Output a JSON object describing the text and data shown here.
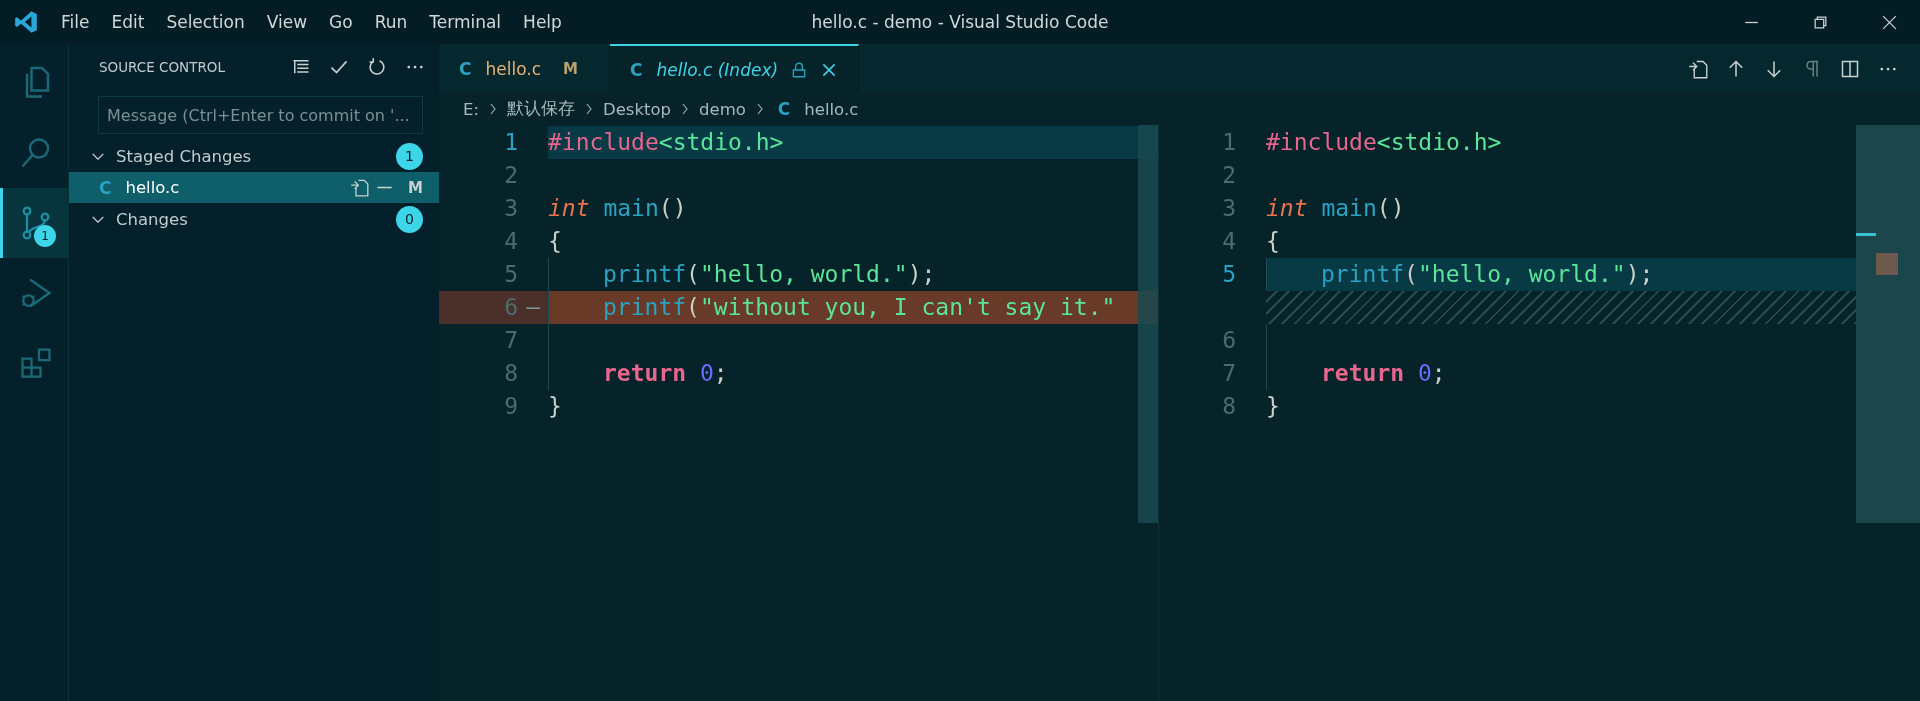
{
  "titlebar": {
    "menus": [
      "File",
      "Edit",
      "Selection",
      "View",
      "Go",
      "Run",
      "Terminal",
      "Help"
    ],
    "title": "hello.c - demo - Visual Studio Code"
  },
  "activity_bar": [
    {
      "kind": "files",
      "selected": false
    },
    {
      "kind": "search",
      "selected": false
    },
    {
      "kind": "source-control",
      "selected": true,
      "badge": "1"
    },
    {
      "kind": "run",
      "selected": false
    },
    {
      "kind": "extensions",
      "selected": false
    }
  ],
  "sidebar": {
    "title": "SOURCE CONTROL",
    "message": {
      "placeholder": "Message (Ctrl+Enter to commit on '..."
    },
    "groups": [
      {
        "label": "Staged Changes",
        "count": "1",
        "expanded": true,
        "files": [
          {
            "icon_letter": "C",
            "name": "hello.c",
            "status": "M",
            "selected": true
          }
        ]
      },
      {
        "label": "Changes",
        "count": "0",
        "expanded": true
      }
    ]
  },
  "tabs": [
    {
      "icon_letter": "C",
      "label": "hello.c",
      "status": "M",
      "selected": false,
      "locked": false
    },
    {
      "icon_letter": "C",
      "label": "hello.c (Index)",
      "selected": true,
      "locked": true
    }
  ],
  "breadcrumb": [
    {
      "label": "E:"
    },
    {
      "label": "默认保存"
    },
    {
      "label": "Desktop"
    },
    {
      "label": "demo"
    },
    {
      "icon_letter": "C",
      "label": "hello.c"
    }
  ],
  "diff": {
    "left": {
      "lines": [
        {
          "number": "1",
          "kind": "current",
          "tokens": [
            {
              "t": "#include",
              "kind": "pre"
            },
            {
              "t": "<stdio.h>",
              "kind": "str"
            }
          ]
        },
        {
          "number": "2",
          "kind": "normal"
        },
        {
          "number": "3",
          "kind": "normal",
          "tokens": [
            {
              "t": "int",
              "kind": "type"
            },
            {
              "t": " main",
              "kind": "fn"
            },
            {
              "t": "()",
              "kind": "punct"
            }
          ]
        },
        {
          "number": "4",
          "kind": "normal",
          "tokens": [
            {
              "t": "{",
              "kind": "punct"
            }
          ]
        },
        {
          "number": "5",
          "kind": "normal",
          "indented": true,
          "tokens": [
            {
              "t": "printf",
              "kind": "fn"
            },
            {
              "t": "(",
              "kind": "punct"
            },
            {
              "t": "\"hello, world.\"",
              "kind": "str"
            },
            {
              "t": ");",
              "kind": "punct"
            }
          ]
        },
        {
          "number": "6",
          "kind": "removed",
          "marker": "—",
          "indented": true,
          "tokens": [
            {
              "t": "printf",
              "kind": "fn"
            },
            {
              "t": "(",
              "kind": "punct"
            },
            {
              "t": "\"without you, I can't say it.\"",
              "kind": "str"
            }
          ]
        },
        {
          "number": "7",
          "kind": "normal",
          "indented": true
        },
        {
          "number": "8",
          "kind": "normal",
          "indented": true,
          "tokens": [
            {
              "t": "return",
              "kind": "kw"
            },
            {
              "t": " 0",
              "kind": "num"
            },
            {
              "t": ";",
              "kind": "punct"
            }
          ]
        },
        {
          "number": "9",
          "kind": "normal",
          "tokens": [
            {
              "t": "}",
              "kind": "punct"
            }
          ]
        }
      ]
    },
    "right": {
      "lines": [
        {
          "number": "1",
          "kind": "normal",
          "tokens": [
            {
              "t": "#include",
              "kind": "pre"
            },
            {
              "t": "<stdio.h>",
              "kind": "str"
            }
          ]
        },
        {
          "number": "2",
          "kind": "normal"
        },
        {
          "number": "3",
          "kind": "normal",
          "tokens": [
            {
              "t": "int",
              "kind": "type"
            },
            {
              "t": " main",
              "kind": "fn"
            },
            {
              "t": "()",
              "kind": "punct"
            }
          ]
        },
        {
          "number": "4",
          "kind": "normal",
          "tokens": [
            {
              "t": "{",
              "kind": "punct"
            }
          ]
        },
        {
          "number": "5",
          "kind": "current",
          "indented": true,
          "tokens": [
            {
              "t": "printf",
              "kind": "fn"
            },
            {
              "t": "(",
              "kind": "punct"
            },
            {
              "t": "\"hello, world.\"",
              "kind": "str"
            },
            {
              "t": ");",
              "kind": "punct"
            }
          ]
        },
        {
          "kind": "filler"
        },
        {
          "number": "6",
          "kind": "normal",
          "indented": true
        },
        {
          "number": "7",
          "kind": "normal",
          "indented": true,
          "tokens": [
            {
              "t": "return",
              "kind": "kw"
            },
            {
              "t": " 0",
              "kind": "num"
            },
            {
              "t": ";",
              "kind": "punct"
            }
          ]
        },
        {
          "number": "8",
          "kind": "normal",
          "tokens": [
            {
              "t": "}",
              "kind": "punct"
            }
          ]
        }
      ]
    }
  }
}
